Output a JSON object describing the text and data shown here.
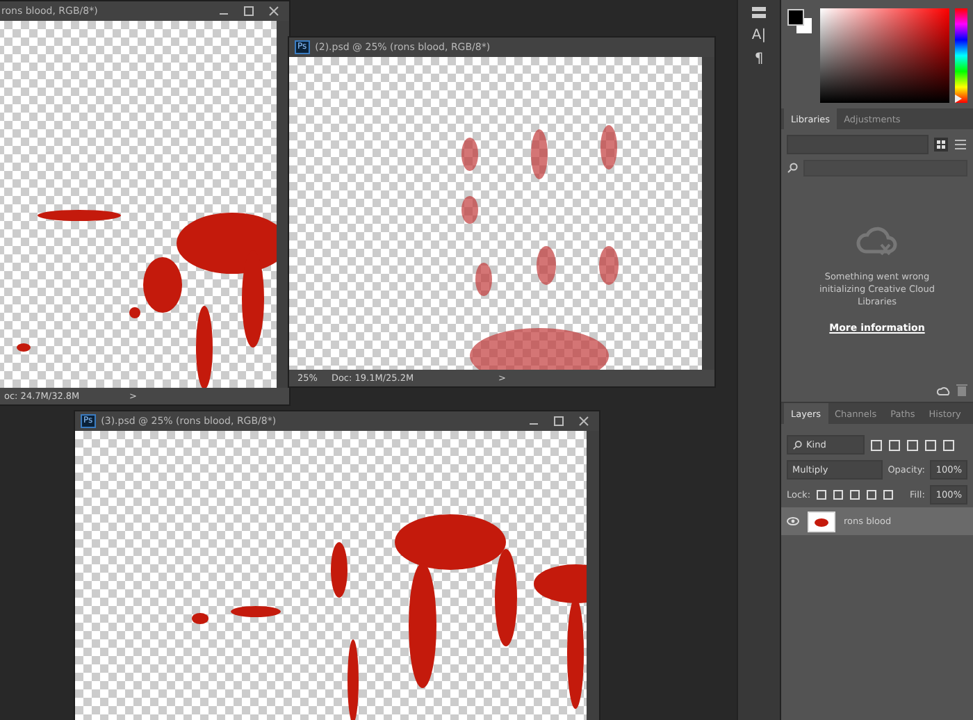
{
  "documents": [
    {
      "title": "rons blood, RGB/8*)",
      "status": "oc: 24.7M/32.8M",
      "status_arrow": ">",
      "controls": true
    },
    {
      "badge": "Ps",
      "title": "(2).psd @ 25% (rons blood, RGB/8*)",
      "zoom": "25%",
      "status": "Doc: 19.1M/25.2M",
      "status_arrow": ">",
      "controls": false
    },
    {
      "badge": "Ps",
      "title": "(3).psd @ 25% (rons blood, RGB/8*)",
      "controls": true
    }
  ],
  "tools": [
    "A|",
    "¶"
  ],
  "hue_slider": {
    "level": 0
  },
  "libraries_panel": {
    "tabs": [
      {
        "label": "Libraries",
        "selected": true
      },
      {
        "label": "Adjustments",
        "selected": false
      }
    ],
    "message": "Something went wrong initializing Creative Cloud Libraries",
    "link": "More information"
  },
  "layers_panel": {
    "tabs": [
      {
        "label": "Layers",
        "selected": true
      },
      {
        "label": "Channels",
        "selected": false
      },
      {
        "label": "Paths",
        "selected": false
      },
      {
        "label": "History",
        "selected": false
      }
    ],
    "filter": "Kind",
    "blend_mode": "Multiply",
    "opacity_label": "Opacity:",
    "opacity": "100%",
    "lock_label": "Lock:",
    "fill_label": "Fill:",
    "fill": "100%",
    "layers": [
      {
        "name": "rons blood",
        "visible": true,
        "selected": true
      }
    ]
  }
}
